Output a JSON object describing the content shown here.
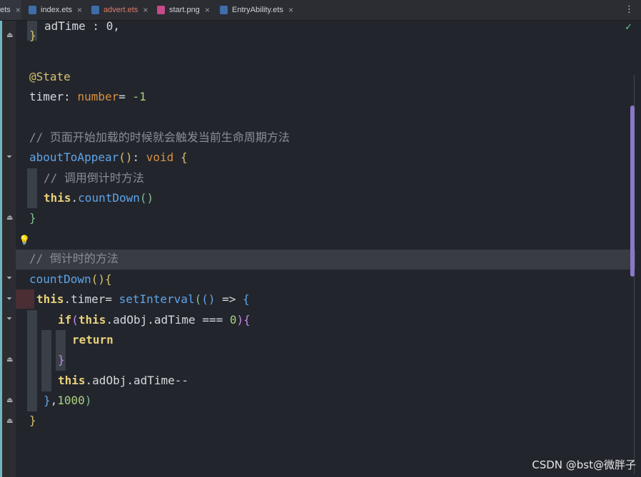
{
  "tabs": [
    {
      "label": "ets",
      "close": "×"
    },
    {
      "label": "index.ets",
      "close": "×",
      "icon": "ets-file-icon"
    },
    {
      "label": "advert.ets",
      "close": "×",
      "icon": "ets-file-icon",
      "modified": true
    },
    {
      "label": "start.png",
      "close": "×",
      "icon": "image-file-icon"
    },
    {
      "label": "EntryAbility.ets",
      "close": "×",
      "icon": "ets-file-icon"
    }
  ],
  "menu_label": "⋮",
  "code": {
    "line_top": "adTime : 0,",
    "annotation": "@State",
    "timer_name": "timer",
    "timer_type": "number",
    "timer_value": "-1",
    "comment_lifecycle": "// 页面开始加载的时候就会触发当前生命周期方法",
    "about_fn": "aboutToAppear",
    "void": "void",
    "comment_call": "// 调用倒计时方法",
    "this": "this",
    "countdown_call": "countDown",
    "comment_method": "// 倒计时的方法",
    "countdown_fn": "countDown",
    "timer_prop": "timer",
    "set_interval": "setInterval",
    "if_kw": "if",
    "ad_obj": "adObj",
    "ad_time": "adTime",
    "zero": "0",
    "return_kw": "return",
    "decrement": "--",
    "interval_ms": "1000"
  },
  "watermark": "CSDN @bst@微胖子",
  "colors": {
    "background": "#23252d",
    "accent": "#6fb7c0",
    "scroll_thumb": "#8a79c8"
  }
}
